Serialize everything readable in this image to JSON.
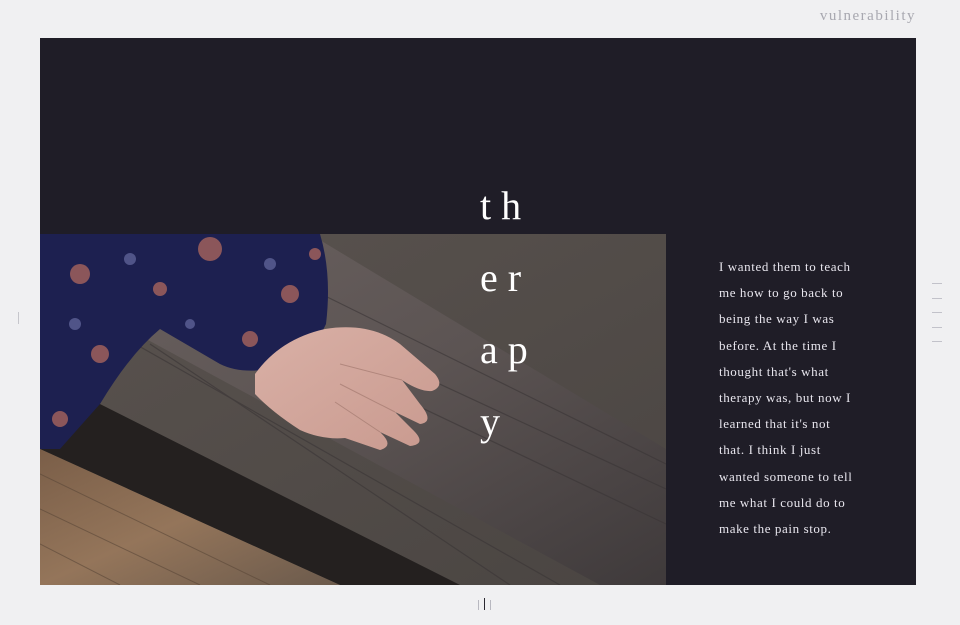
{
  "header": {
    "site_label": "vulnerability"
  },
  "title": {
    "lines": [
      "th",
      "er",
      "ap",
      "y"
    ]
  },
  "quote": {
    "lines": [
      "I wanted them to teach",
      "me how to go back to",
      "being the way I was",
      "before. At the time I",
      "thought that's what",
      "therapy was, but now I",
      "learned that it's not",
      "that. I think I just",
      "wanted someone to tell",
      "me what I could do to",
      "make the pain stop."
    ]
  },
  "photo": {
    "subject": "hand-on-wooden-bench"
  },
  "colors": {
    "page_bg": "#f0f0f2",
    "panel_bg": "#1f1d27",
    "title_text": "#ffffff",
    "quote_text": "#e8e6ee",
    "label_text": "#a8a8b0"
  },
  "pager": {
    "count": 3,
    "active_index": 1
  },
  "side_nav": {
    "count": 5
  }
}
